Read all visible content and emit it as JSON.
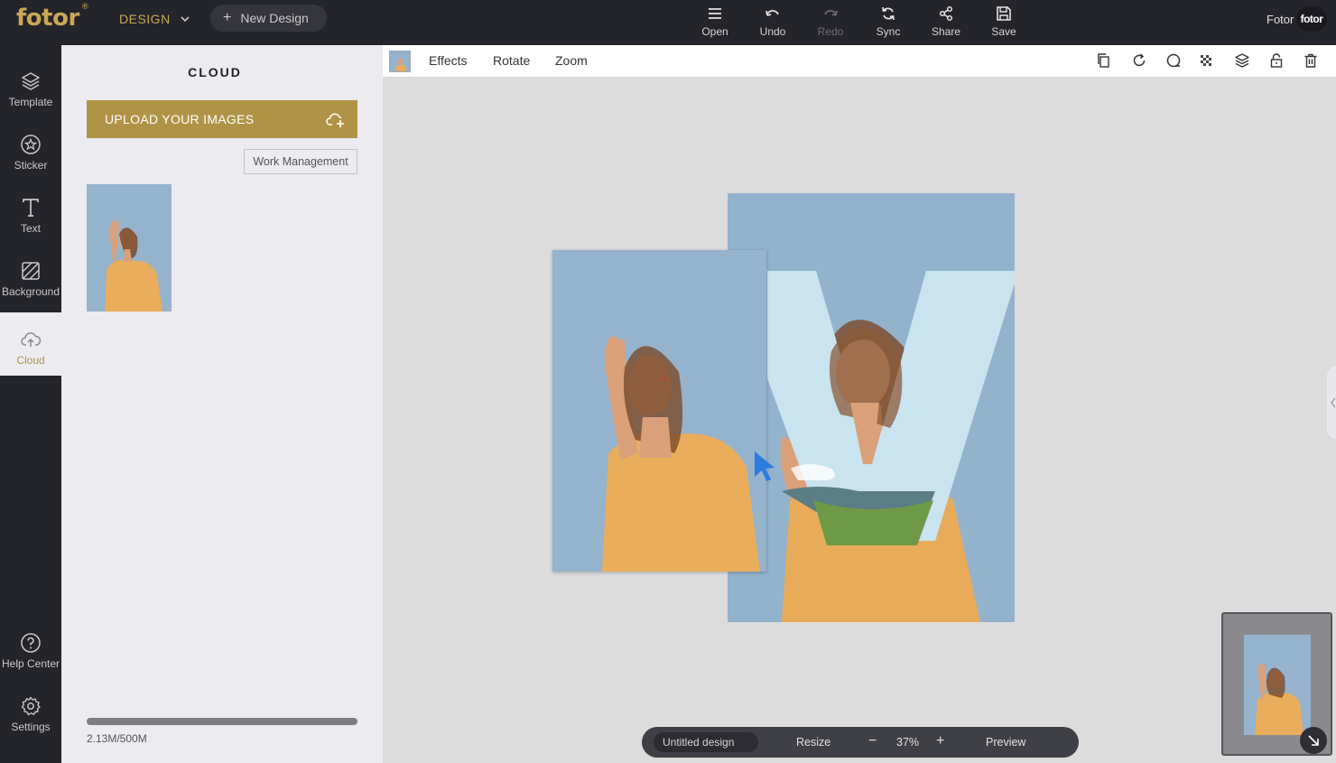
{
  "app": {
    "logo": "fotor",
    "logo_mark": "®",
    "mode_label": "DESIGN",
    "new_design_label": "New Design",
    "user_name": "Fotor",
    "avatar_text": "fotor"
  },
  "toolbar": {
    "open": "Open",
    "undo": "Undo",
    "redo": "Redo",
    "sync": "Sync",
    "share": "Share",
    "save": "Save"
  },
  "rail": {
    "items": [
      {
        "label": "Template",
        "icon": "layers-icon"
      },
      {
        "label": "Sticker",
        "icon": "star-badge-icon"
      },
      {
        "label": "Text",
        "icon": "text-icon"
      },
      {
        "label": "Background",
        "icon": "background-hatch-icon"
      },
      {
        "label": "Cloud",
        "icon": "cloud-upload-icon"
      }
    ],
    "bottom": [
      {
        "label": "Help Center",
        "icon": "help-icon"
      },
      {
        "label": "Settings",
        "icon": "gear-icon"
      }
    ]
  },
  "panel": {
    "title": "CLOUD",
    "upload_label": "UPLOAD YOUR IMAGES",
    "work_management_label": "Work Management",
    "storage_text": "2.13M/500M",
    "storage_used_fraction": 0.004
  },
  "edit_toolbar": {
    "tabs": [
      "Effects",
      "Rotate",
      "Zoom"
    ],
    "icons": [
      "copy-icon",
      "refresh-icon",
      "mask-icon",
      "transparency-icon",
      "layers-icon",
      "lock-icon",
      "trash-icon"
    ]
  },
  "bottom_bar": {
    "design_name": "Untitled design",
    "resize_label": "Resize",
    "minus": "−",
    "zoom_value": "37%",
    "plus": "+",
    "preview_label": "Preview"
  },
  "colors": {
    "accent": "#b09446",
    "topbar": "#24242b",
    "panel": "#ebebf0",
    "canvas": "#dcdcdc",
    "sky": "#93b2cc"
  }
}
